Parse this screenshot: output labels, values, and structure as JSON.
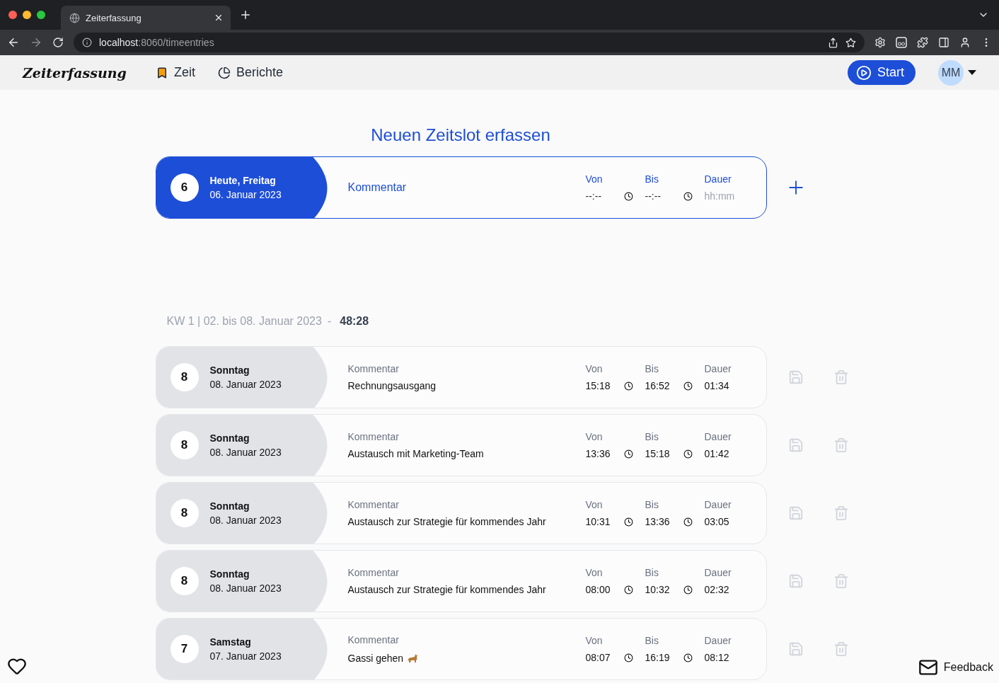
{
  "browser": {
    "tab_title": "Zeiterfassung",
    "url": {
      "host": "localhost",
      "path": ":8060/timeentries"
    }
  },
  "app": {
    "logo": "Zeiterfassung",
    "nav": [
      {
        "label": "Zeit",
        "selected": true
      },
      {
        "label": "Berichte",
        "selected": false
      }
    ],
    "start_button": "Start",
    "avatar": "MM"
  },
  "new_entry": {
    "heading": "Neuen Zeitslot erfassen",
    "day_number": "6",
    "day_label": "Heute, Freitag",
    "date": "06. Januar 2023",
    "comment_placeholder": "Kommentar",
    "from_label": "Von",
    "from_placeholder": "--:--",
    "to_label": "Bis",
    "to_placeholder": "--:--",
    "duration_label": "Dauer",
    "duration_placeholder": "hh:mm"
  },
  "week": {
    "label": "KW 1 | 02. bis 08. Januar 2023",
    "separator": "-",
    "total": "48:28"
  },
  "entries": [
    {
      "day_number": "8",
      "weekday": "Sonntag",
      "date": "08. Januar 2023",
      "comment_label": "Kommentar",
      "comment": "Rechnungsausgang",
      "from_label": "Von",
      "from": "15:18",
      "to_label": "Bis",
      "to": "16:52",
      "duration_label": "Dauer",
      "duration": "01:34"
    },
    {
      "day_number": "8",
      "weekday": "Sonntag",
      "date": "08. Januar 2023",
      "comment_label": "Kommentar",
      "comment": "Austausch mit Marketing-Team",
      "from_label": "Von",
      "from": "13:36",
      "to_label": "Bis",
      "to": "15:18",
      "duration_label": "Dauer",
      "duration": "01:42"
    },
    {
      "day_number": "8",
      "weekday": "Sonntag",
      "date": "08. Januar 2023",
      "comment_label": "Kommentar",
      "comment": "Austausch zur Strategie für kommendes Jahr",
      "from_label": "Von",
      "from": "10:31",
      "to_label": "Bis",
      "to": "13:36",
      "duration_label": "Dauer",
      "duration": "03:05"
    },
    {
      "day_number": "8",
      "weekday": "Sonntag",
      "date": "08. Januar 2023",
      "comment_label": "Kommentar",
      "comment": "Austausch zur Strategie für kommendes Jahr",
      "from_label": "Von",
      "from": "08:00",
      "to_label": "Bis",
      "to": "10:32",
      "duration_label": "Dauer",
      "duration": "02:32"
    },
    {
      "day_number": "7",
      "weekday": "Samstag",
      "date": "07. Januar 2023",
      "comment_label": "Kommentar",
      "comment": "Gassi gehen",
      "from_label": "Von",
      "from": "08:07",
      "to_label": "Bis",
      "to": "16:19",
      "duration_label": "Dauer",
      "duration": "08:12"
    }
  ],
  "feedback": "Feedback"
}
